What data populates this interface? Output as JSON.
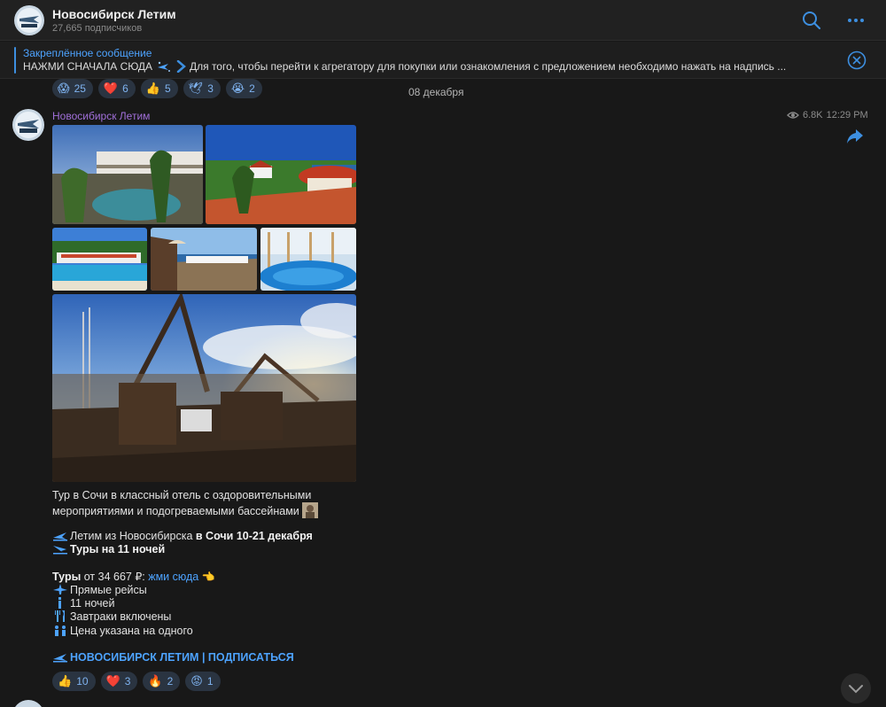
{
  "header": {
    "channel_name": "Новосибирск Летим",
    "subscribers": "27,665 подписчиков"
  },
  "pinned": {
    "title": "Закреплённое сообщение",
    "text_bold": "НАЖМИ СНАЧАЛА СЮДА",
    "text_rest": "Для того, чтобы перейти к агрегатору для покупки или ознакомления с предложением необходимо нажать на надпись ..."
  },
  "top_reactions": [
    {
      "emoji": "😱",
      "count": "25"
    },
    {
      "emoji": "❤️",
      "count": "6"
    },
    {
      "emoji": "👍",
      "count": "5"
    },
    {
      "emoji": "🕊",
      "count": "3"
    },
    {
      "emoji": "😭",
      "count": "2"
    }
  ],
  "date_separator": "08 декабря",
  "post": {
    "author": "Новосибирск Летим",
    "views": "6.8K",
    "time": "12:29 PM",
    "line1": "Тур в Сочи в классный отель с оздоровительными",
    "line2": "мероприятиями и подогреваемыми бассейнами",
    "fly_prefix": "Летим из Новосибирска ",
    "fly_bold": "в Сочи 10-21 декабря",
    "tours_nights": "Туры на 11 ночей",
    "price_bold": "Туры",
    "price_text": " от 34 667 ₽: ",
    "price_link": "жми сюда",
    "feature_direct": "Прямые рейсы",
    "feature_nights": "11 ночей",
    "feature_breakfast": "Завтраки включены",
    "feature_price": "Цена указана на одного",
    "subscribe_link": "НОВОСИБИРСК ЛЕТИМ | ПОДПИСАТЬСЯ",
    "reactions": [
      {
        "emoji": "👍",
        "count": "10"
      },
      {
        "emoji": "❤️",
        "count": "3"
      },
      {
        "emoji": "🔥",
        "count": "2"
      },
      {
        "emoji": "😡",
        "count": "1"
      }
    ]
  },
  "colors": {
    "accent": "#4da3ff",
    "author": "#a06fd8",
    "background": "#181818"
  }
}
